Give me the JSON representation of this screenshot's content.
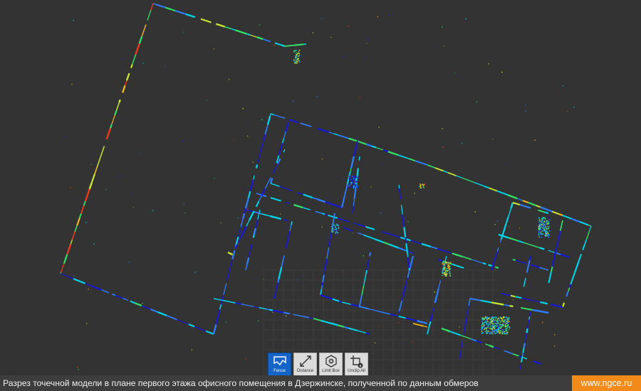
{
  "viewer": {
    "background": "#333333",
    "pointcloud_colormap": [
      "#1a1acc",
      "#2e7dff",
      "#00d2e6",
      "#33e066",
      "#c8e632",
      "#f0b41e",
      "#e63c1e"
    ]
  },
  "toolbar": {
    "tools": [
      {
        "label": "Fence",
        "icon": "fence-icon",
        "active": true
      },
      {
        "label": "Distance",
        "icon": "distance-icon",
        "active": false
      },
      {
        "label": "Limit Box",
        "icon": "limit-box-icon",
        "active": false
      },
      {
        "label": "Unclip All",
        "icon": "unclip-all-icon",
        "active": false
      }
    ],
    "active_color": "#1565c8"
  },
  "caption": {
    "text": "Разрез точечной модели в плане первого этажа офисного помещения в Дзержинске, полученной по данным обмеров",
    "site": "www.ngce.ru",
    "site_color": "#f28a1a"
  }
}
